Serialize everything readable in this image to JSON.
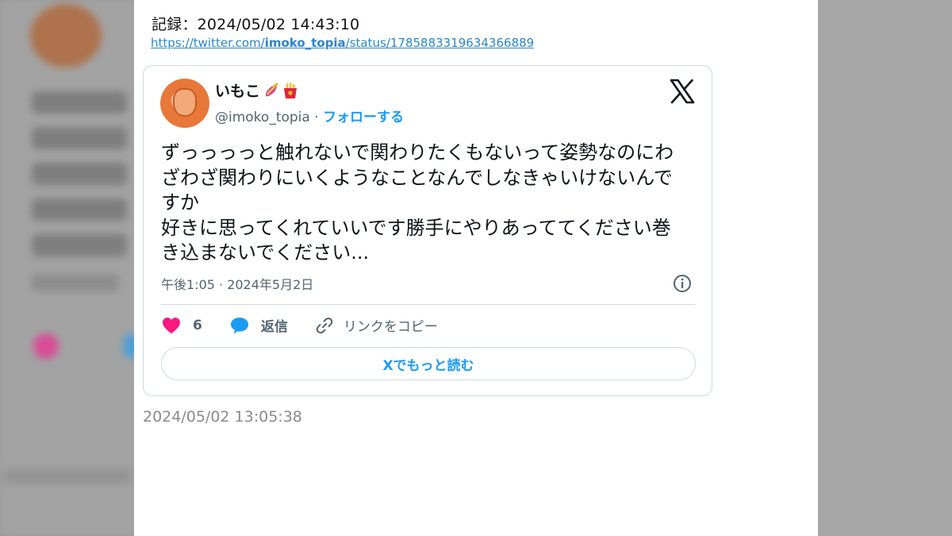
{
  "record": {
    "label": "記録：2024/05/02 14:43:10",
    "url_prefix": "https://twitter.com/",
    "url_user": "imoko_topia",
    "url_suffix": "/status/1785883319634366889"
  },
  "tweet": {
    "display_name": "いもこ",
    "name_emojis": [
      "sweet-potato-icon",
      "fries-icon"
    ],
    "handle": "@imoko_topia",
    "separator": " · ",
    "follow_label": "フォローする",
    "text": "ずっっっっと触れないで関わりたくもないって姿勢なのにわざわざ関わりにいくようなことなんでしなきゃいけないんですか\n好きに思ってくれていいです勝手にやりあっててください巻き込まないでください...",
    "timestamp": "午後1:05 · 2024年5月2日",
    "likes": "6",
    "reply_label": "返信",
    "copy_link_label": "リンクをコピー",
    "read_more_label": "Xでもっと読む"
  },
  "footer": {
    "time": "2024/05/02 13:05:38"
  },
  "colors": {
    "accent": "#1d9bf0",
    "like": "#f91880",
    "link": "#2a86c8",
    "muted": "#536471"
  }
}
